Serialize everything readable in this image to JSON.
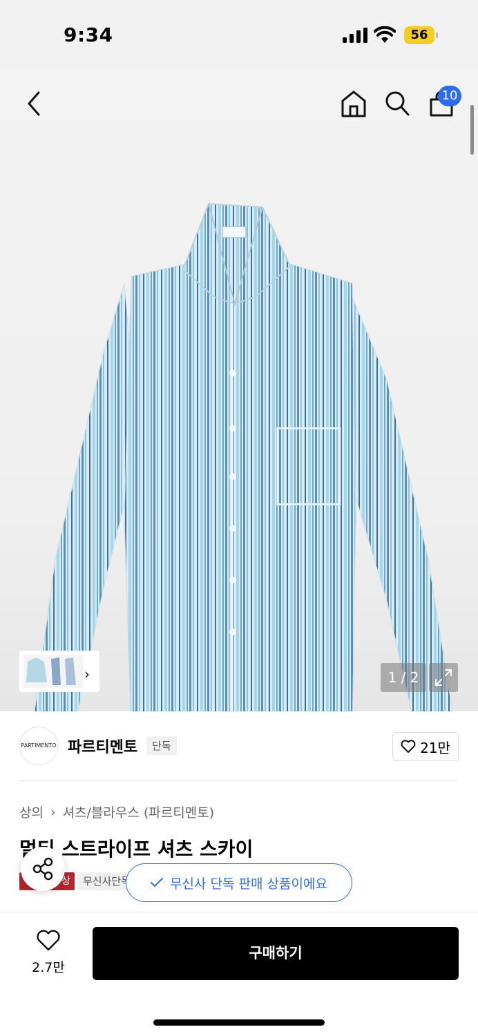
{
  "status_bar": {
    "time": "9:34",
    "battery": "56"
  },
  "header": {
    "cart_count": "10"
  },
  "gallery": {
    "pager": "1 / 2",
    "thumb_brand_mark": "PARTIMENTO"
  },
  "brand": {
    "name": "파르티멘토",
    "logo_text": "PARTIMENTO",
    "exclusive_label": "단독",
    "likes": "21만"
  },
  "breadcrumb": [
    "상의",
    "셔츠/블라우스 (파르티멘토)"
  ],
  "product": {
    "title": "멀티 스트라이프 셔츠 스카이",
    "badge_red": "상",
    "badge_gray": "무신사단독"
  },
  "toast": {
    "text": "무신사 단독 판매 상품이에요"
  },
  "bottom_bar": {
    "like_count": "2.7만",
    "buy_label": "구매하기"
  },
  "colors": {
    "accent_blue": "#2d6cf0",
    "badge_red": "#b3262e",
    "battery_yellow": "#f7cd24"
  },
  "icons": [
    "back-icon",
    "home-icon",
    "search-icon",
    "cart-icon",
    "expand-icon",
    "heart-icon",
    "share-icon",
    "check-icon",
    "chevron-right-icon"
  ]
}
